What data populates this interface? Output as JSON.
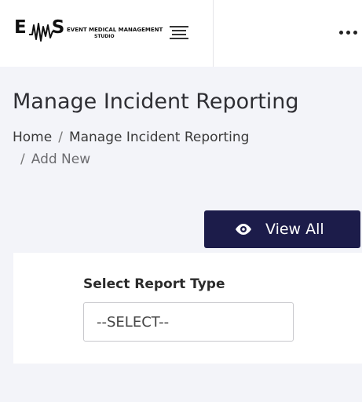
{
  "brand": {
    "letters_left": "E",
    "letters_right": "S",
    "line1": "EVENT MEDICAL MANAGEMENT",
    "line2": "STUDIO"
  },
  "icons": {
    "menu": "hamburger-icon",
    "more": "more-dots-icon",
    "view": "eye-icon"
  },
  "page": {
    "title": "Manage Incident Reporting"
  },
  "breadcrumb": {
    "home": "Home",
    "separator": "/",
    "section": "Manage Incident Reporting",
    "current": "Add New"
  },
  "actions": {
    "view_all_label": "View All"
  },
  "form": {
    "report_type_label": "Select Report Type",
    "report_type_value": "--SELECT--"
  },
  "colors": {
    "primary_button": "#1c1c4a",
    "page_background": "#f3f4f9"
  }
}
